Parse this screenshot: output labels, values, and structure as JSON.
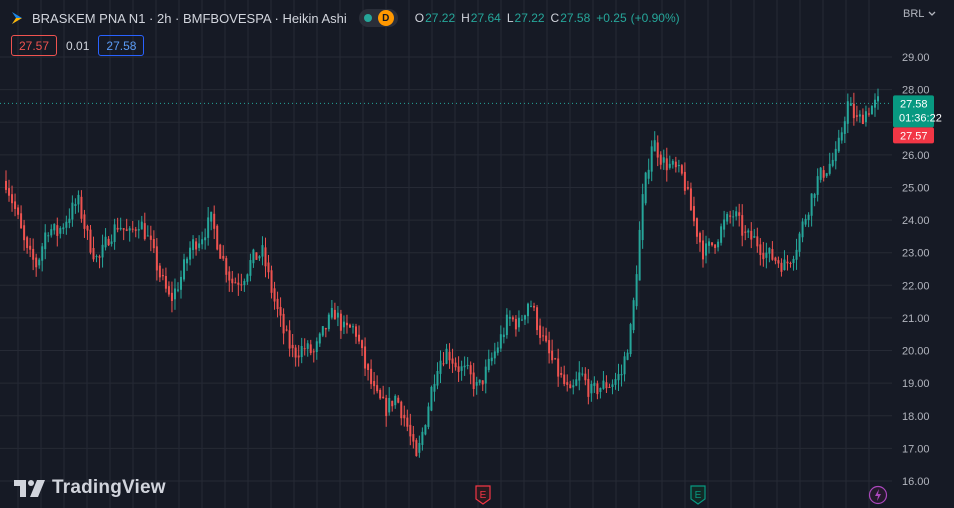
{
  "header": {
    "title": "BRASKEM PNA N1 · 2h · BMFBOVESPA · Heikin Ashi",
    "status_badge": "D",
    "ohlc": {
      "o_label": "O",
      "o_value": "27.22",
      "h_label": "H",
      "h_value": "27.64",
      "l_label": "L",
      "l_value": "27.22",
      "c_label": "C",
      "c_value": "27.58",
      "change": "+0.25",
      "change_pct": "(+0.90%)"
    }
  },
  "trade": {
    "sell_price": "27.57",
    "spread": "0.01",
    "buy_price": "27.58"
  },
  "currency": "BRL",
  "watermark": "TradingView",
  "markers": [
    {
      "icon": "earnings-icon",
      "label": "E",
      "color": "#f23645"
    },
    {
      "icon": "earnings-icon",
      "label": "E",
      "color": "#089981"
    },
    {
      "icon": "lightning-icon",
      "label": "",
      "color": "#ab47bc"
    }
  ],
  "price_labels": {
    "last": "27.58",
    "countdown": "01:36:22",
    "bid": "27.57"
  },
  "colors": {
    "bg": "#161a25",
    "up": "#26a69a",
    "down": "#ef5350",
    "text": "#d1d4dc",
    "grid": "#262a35"
  },
  "chart_data": {
    "type": "candlestick",
    "style": "Heikin Ashi",
    "yaxis_ticks": [
      "29.00",
      "28.00",
      "27.00",
      "26.00",
      "25.00",
      "24.00",
      "23.00",
      "22.00",
      "21.00",
      "20.00",
      "19.00",
      "18.00",
      "17.00",
      "16.00"
    ],
    "ylim": [
      15.8,
      29.6
    ],
    "grid": true,
    "last_price": 27.58,
    "close_path": [
      25.2,
      24.2,
      23.0,
      22.6,
      23.8,
      23.6,
      24.1,
      24.6,
      23.4,
      22.7,
      23.5,
      23.9,
      23.5,
      24.0,
      23.3,
      22.3,
      21.5,
      22.2,
      23.2,
      23.5,
      24.0,
      22.9,
      22.1,
      22.2,
      22.8,
      23.0,
      21.7,
      20.6,
      19.9,
      20.1,
      19.9,
      20.6,
      21.2,
      20.6,
      20.7,
      19.5,
      18.6,
      18.2,
      18.6,
      17.8,
      16.6,
      18.1,
      19.6,
      20.0,
      19.5,
      19.3,
      18.8,
      19.5,
      20.2,
      21.0,
      20.8,
      21.6,
      20.6,
      19.8,
      19.2,
      18.6,
      19.3,
      18.7,
      18.9,
      19.0,
      19.3,
      20.8,
      24.5,
      26.5,
      25.8,
      25.6,
      25.3,
      24.0,
      23.0,
      23.3,
      23.9,
      24.2,
      23.5,
      23.4,
      23.0,
      22.8,
      22.6,
      23.2,
      24.2,
      25.2,
      25.6,
      26.0,
      27.6,
      27.0,
      27.4,
      27.6
    ]
  }
}
